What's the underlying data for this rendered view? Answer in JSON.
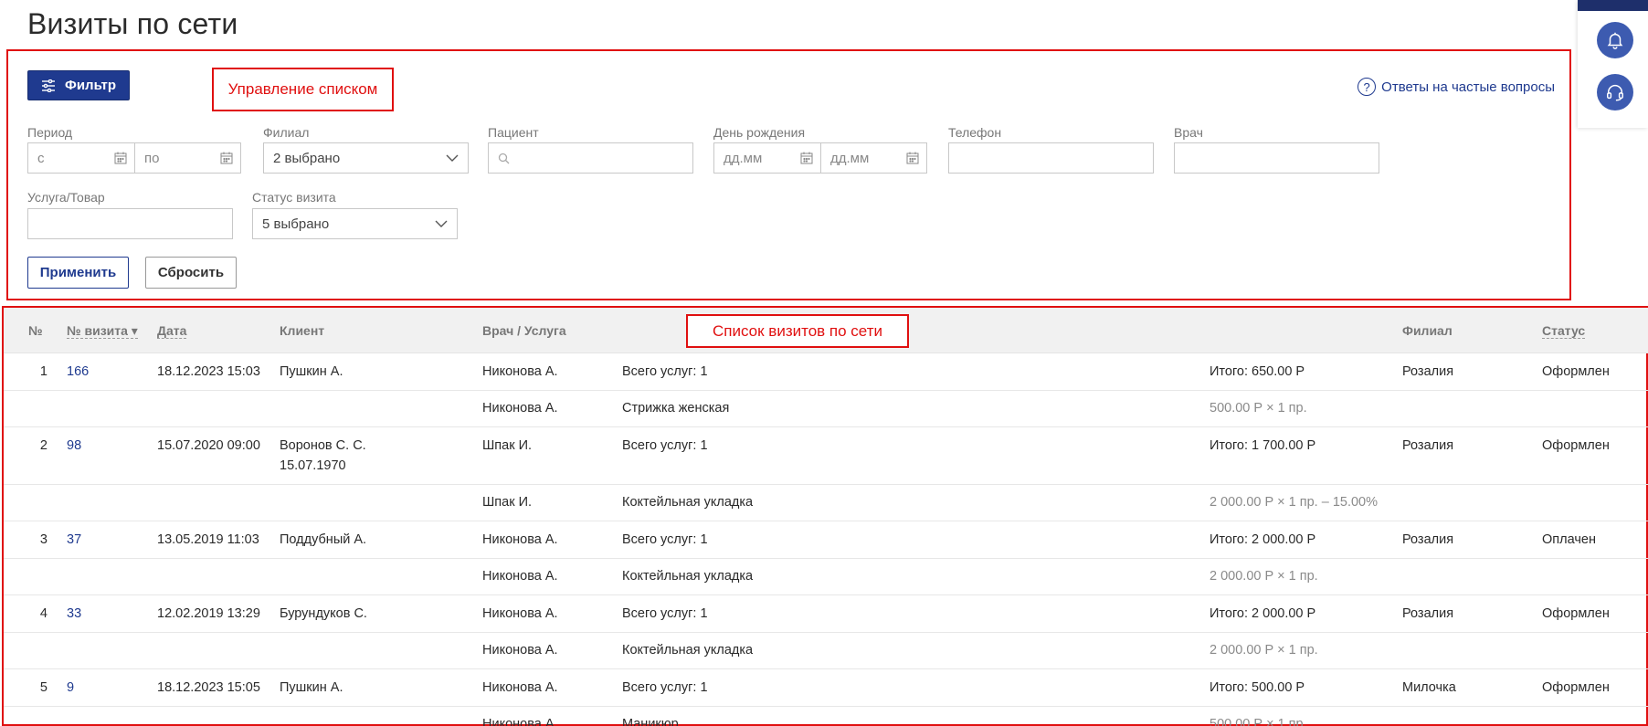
{
  "page": {
    "title": "Визиты по сети"
  },
  "annotations": {
    "filter_area": "Управление списком",
    "visits_area": "Список визитов по сети"
  },
  "toolbar": {
    "filter_label": "Фильтр",
    "faq_label": "Ответы на частые вопросы",
    "faq_symbol": "?"
  },
  "filters": {
    "period": {
      "label": "Период",
      "from_placeholder": "с",
      "to_placeholder": "по"
    },
    "branch": {
      "label": "Филиал",
      "value": "2 выбрано"
    },
    "patient": {
      "label": "Пациент",
      "value": ""
    },
    "birthday": {
      "label": "День рождения",
      "from_placeholder": "дд.мм",
      "to_placeholder": "дд.мм"
    },
    "phone": {
      "label": "Телефон",
      "value": ""
    },
    "doctor": {
      "label": "Врач",
      "value": ""
    },
    "service": {
      "label": "Услуга/Товар",
      "value": ""
    },
    "status": {
      "label": "Статус визита",
      "value": "5 выбрано"
    },
    "apply_label": "Применить",
    "reset_label": "Сбросить"
  },
  "table": {
    "headers": {
      "num": "№",
      "visit_no": "№ визита ▾",
      "date": "Дата",
      "client": "Клиент",
      "doctor_service": "Врач / Услуга",
      "branch": "Филиал",
      "status": "Статус"
    },
    "rows": [
      {
        "num": "1",
        "visit": "166",
        "date": "18.12.2023 15:03",
        "client": "Пушкин А.",
        "client2": "",
        "doctor": "Никонова А.",
        "service": "Всего услуг: 1",
        "total": "Итого: 650.00 Р",
        "branch": "Розалия",
        "status": "Оформлен"
      },
      {
        "doctor": "Никонова А.",
        "service": "Стрижка женская",
        "price": "500.00 Р × 1 пр."
      },
      {
        "num": "2",
        "visit": "98",
        "date": "15.07.2020 09:00",
        "client": "Воронов С. С.",
        "client2": "15.07.1970",
        "doctor": "Шпак И.",
        "service": "Всего услуг: 1",
        "total": "Итого: 1 700.00 Р",
        "branch": "Розалия",
        "status": "Оформлен"
      },
      {
        "doctor": "Шпак И.",
        "service": "Коктейльная укладка",
        "price": "2 000.00 Р × 1 пр. – 15.00%"
      },
      {
        "num": "3",
        "visit": "37",
        "date": "13.05.2019 11:03",
        "client": "Поддубный А.",
        "client2": "",
        "doctor": "Никонова А.",
        "service": "Всего услуг: 1",
        "total": "Итого: 2 000.00 Р",
        "branch": "Розалия",
        "status": "Оплачен"
      },
      {
        "doctor": "Никонова А.",
        "service": "Коктейльная укладка",
        "price": "2 000.00 Р × 1 пр."
      },
      {
        "num": "4",
        "visit": "33",
        "date": "12.02.2019 13:29",
        "client": "Бурундуков С.",
        "client2": "",
        "doctor": "Никонова А.",
        "service": "Всего услуг: 1",
        "total": "Итого: 2 000.00 Р",
        "branch": "Розалия",
        "status": "Оформлен"
      },
      {
        "doctor": "Никонова А.",
        "service": "Коктейльная укладка",
        "price": "2 000.00 Р × 1 пр."
      },
      {
        "num": "5",
        "visit": "9",
        "date": "18.12.2023 15:05",
        "client": "Пушкин А.",
        "client2": "",
        "doctor": "Никонова А.",
        "service": "Всего услуг: 1",
        "total": "Итого: 500.00 Р",
        "branch": "Милочка",
        "status": "Оформлен"
      },
      {
        "doctor": "Никонова А.",
        "service": "Маникюр",
        "price": "500.00 Р × 1 пр."
      }
    ]
  },
  "colors": {
    "accent": "#1f3a8f",
    "annotation": "#e01010",
    "rail_button": "#3d5bb0"
  },
  "icons": {
    "filter": "sliders-icon",
    "calendar": "calendar-icon",
    "chevron": "chevron-down-icon",
    "search": "search-icon",
    "bell": "bell-icon",
    "support": "headset-icon"
  }
}
